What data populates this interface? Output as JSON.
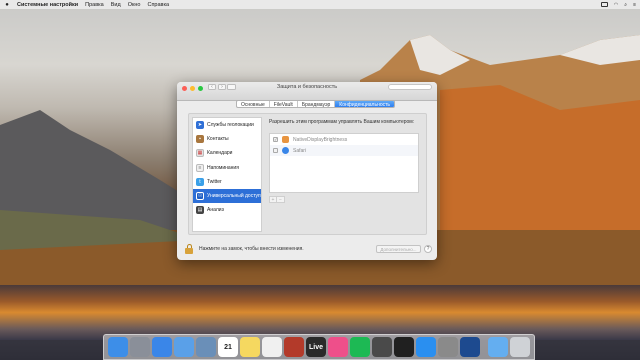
{
  "menubar": {
    "app_name": "Системные настройки",
    "items": [
      "Правка",
      "Вид",
      "Окно",
      "Справка"
    ]
  },
  "window": {
    "title": "Защита и безопасность",
    "tabs": [
      {
        "label": "Основные",
        "active": false
      },
      {
        "label": "FileVault",
        "active": false
      },
      {
        "label": "Брандмауэр",
        "active": false
      },
      {
        "label": "Конфиденциальность",
        "active": true
      }
    ],
    "sidebar": [
      {
        "label": "Службы геолокации",
        "icon": "compass-icon",
        "color": "#2f6fd6"
      },
      {
        "label": "Контакты",
        "icon": "contacts-icon",
        "color": "#a8763e"
      },
      {
        "label": "Календари",
        "icon": "calendar-icon",
        "color": "#e5e5e5"
      },
      {
        "label": "Напоминания",
        "icon": "reminders-icon",
        "color": "#f0f0f0"
      },
      {
        "label": "Twitter",
        "icon": "twitter-icon",
        "color": "#3aa0e8"
      },
      {
        "label": "Универсальный доступ",
        "icon": "accessibility-icon",
        "color": "#2d6fd7",
        "selected": true
      },
      {
        "label": "Анализ",
        "icon": "analytics-icon",
        "color": "#444444"
      }
    ],
    "right_title": "Разрешить этим программам управлять Вашим компьютером:",
    "apps": [
      {
        "name": "NativeDisplayBrightness",
        "checked": true,
        "color": "#e89540"
      },
      {
        "name": "Safari",
        "checked": false,
        "color": "#3a86e8"
      }
    ],
    "add_label": "+",
    "remove_label": "−",
    "lock_text": "Нажмите на замок, чтобы внести изменения.",
    "advanced_label": "Дополнительно...",
    "help_label": "?"
  },
  "colors": {
    "accent": "#2d6fd7",
    "close": "#fc5f57",
    "minimize": "#fdbc2e",
    "zoom": "#28c840"
  },
  "dock": [
    {
      "name": "finder-icon",
      "color": "#3d8ee8",
      "glyph": ""
    },
    {
      "name": "launchpad-icon",
      "color": "#8a8f99",
      "glyph": ""
    },
    {
      "name": "safari-icon",
      "color": "#3a86e8",
      "glyph": ""
    },
    {
      "name": "mail-icon",
      "color": "#5aa0e8",
      "glyph": ""
    },
    {
      "name": "preview-icon",
      "color": "#6a8fb8",
      "glyph": ""
    },
    {
      "name": "calendar-icon",
      "color": "#ffffff",
      "glyph": "21"
    },
    {
      "name": "notes-icon",
      "color": "#f5d860",
      "glyph": ""
    },
    {
      "name": "photos-icon",
      "color": "#f0f0f0",
      "glyph": ""
    },
    {
      "name": "photo-booth-icon",
      "color": "#b33a2a",
      "glyph": ""
    },
    {
      "name": "live-icon",
      "color": "#2a2a2a",
      "glyph": "Live"
    },
    {
      "name": "itunes-icon",
      "color": "#ee4f8a",
      "glyph": ""
    },
    {
      "name": "spotify-icon",
      "color": "#1db954",
      "glyph": ""
    },
    {
      "name": "keynote-icon",
      "color": "#4a4a4a",
      "glyph": ""
    },
    {
      "name": "final-cut-icon",
      "color": "#202020",
      "glyph": ""
    },
    {
      "name": "app-store-icon",
      "color": "#2a8ff0",
      "glyph": ""
    },
    {
      "name": "system-preferences-icon",
      "color": "#8a8a8a",
      "glyph": ""
    },
    {
      "name": "quicktime-icon",
      "color": "#1d4a8f",
      "glyph": ""
    },
    {
      "name": "downloads-folder-icon",
      "color": "#64aef0",
      "glyph": ""
    },
    {
      "name": "trash-icon",
      "color": "#cfd2d6",
      "glyph": ""
    }
  ]
}
